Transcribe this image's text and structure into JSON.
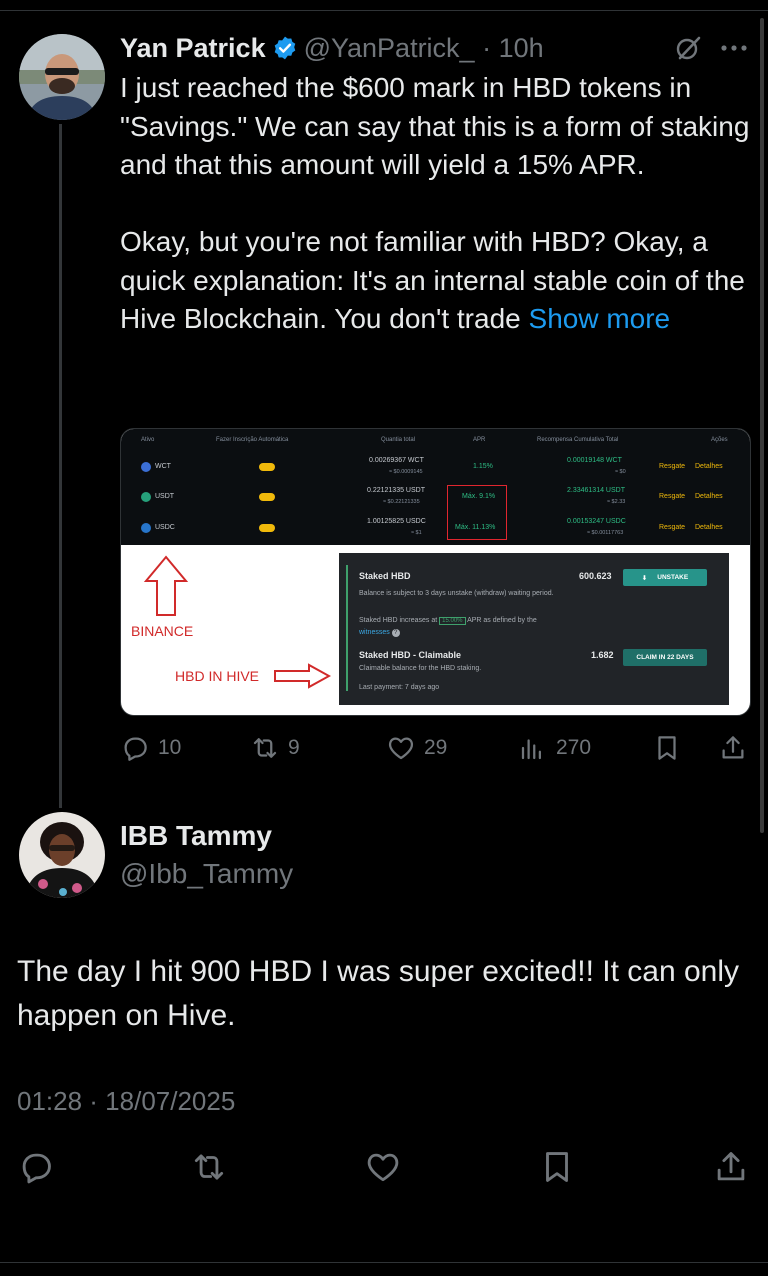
{
  "parent_tweet": {
    "author_name": "Yan Patrick",
    "handle_time": "@YanPatrick_ · 10h",
    "text_p1": "I just reached the $600 mark in HBD tokens in \"Savings.\" We can say that this is a form of staking and that this amount will yield a 15% APR.",
    "text_p2": "Okay, but you're not familiar with HBD? Okay, a quick explanation: It's an internal stable coin of the Hive Blockchain. You don't trade ",
    "show_more": "Show more",
    "icons": [
      "verified-badge-icon",
      "grok-icon",
      "more-icon"
    ],
    "image": {
      "binance": {
        "headers": [
          "Ativo",
          "Fazer Inscrição Automática",
          "Quantia total",
          "APR",
          "Recompensa Cumulativa Total",
          "Ações"
        ],
        "rows": [
          {
            "asset": "WCT",
            "amount": "0.00269367 WCT",
            "amount_usd": "≈ $0.0009145",
            "apr": "1.15%",
            "reward": "0.00019148 WCT",
            "reward_usd": "≈ $0",
            "action1": "Resgate",
            "action2": "Detalhes"
          },
          {
            "asset": "USDT",
            "amount": "0.22121335 USDT",
            "amount_usd": "≈ $0.22121335",
            "apr": "Máx. 9.1%",
            "reward": "2.33461314 USDT",
            "reward_usd": "≈ $2.33",
            "action1": "Resgate",
            "action2": "Detalhes"
          },
          {
            "asset": "USDC",
            "amount": "1.00125825 USDC",
            "amount_usd": "≈ $1",
            "apr": "Máx. 11.13%",
            "reward": "0.00153247 USDC",
            "reward_usd": "≈ $0.00117763",
            "action1": "Resgate",
            "action2": "Detalhes"
          }
        ]
      },
      "hive": {
        "staked_title": "Staked HBD",
        "staked_value": "600.623",
        "unstake_button": "UNSTAKE",
        "staked_desc": "Balance is subject to 3 days unstake (withdraw) waiting period.",
        "apr_pre": "Staked HBD increases at",
        "apr_value": "15.00%",
        "apr_post": "APR as defined by the",
        "apr_link": "witnesses",
        "claimable_title": "Staked HBD - Claimable",
        "claimable_value": "1.682",
        "claim_button": "CLAIM IN 22 DAYS",
        "claimable_desc": "Claimable balance for the HBD staking.",
        "last_payment": "Last payment: 7 days ago"
      },
      "label_binance": "BINANCE",
      "label_hive": "HBD IN HIVE"
    },
    "stats": {
      "replies": "10",
      "retweets": "9",
      "likes": "29",
      "views": "270"
    }
  },
  "reply": {
    "author_name": "IBB Tammy",
    "handle": "@Ibb_Tammy",
    "text": "The day I hit 900 HBD I was super excited!! It can only happen on Hive.",
    "timestamp": "01:28 · 18/07/2025"
  },
  "colors": {
    "background": "#000000",
    "text": "#e7e9ea",
    "muted": "#71767b",
    "link": "#1d9bf0",
    "verified": "#1d9bf0"
  }
}
